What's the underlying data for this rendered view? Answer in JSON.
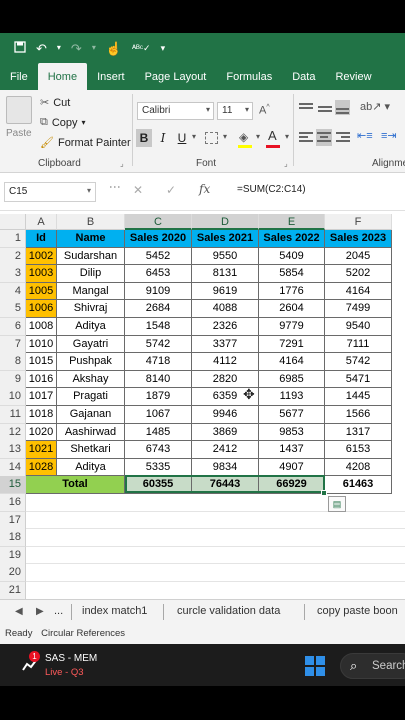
{
  "ribbon": {
    "tabs": [
      "File",
      "Home",
      "Insert",
      "Page Layout",
      "Formulas",
      "Data",
      "Review"
    ],
    "active_tab": "Home",
    "clipboard": {
      "paste": "Paste",
      "cut": "Cut",
      "copy": "Copy",
      "format_painter": "Format Painter",
      "group": "Clipboard"
    },
    "font": {
      "name": "Calibri",
      "size": "11",
      "group": "Font"
    },
    "alignment": {
      "group": "Alignme"
    }
  },
  "formula_bar": {
    "name_box": "C15",
    "formula": "=SUM(C2:C14)"
  },
  "grid": {
    "column_letters": [
      "A",
      "B",
      "C",
      "D",
      "E",
      "F"
    ],
    "row_numbers": [
      "1",
      "2",
      "3",
      "4",
      "5",
      "6",
      "7",
      "8",
      "9",
      "10",
      "11",
      "12",
      "13",
      "14",
      "15",
      "16",
      "17",
      "18",
      "19",
      "20",
      "21"
    ],
    "header": [
      "Id",
      "Name",
      "Sales 2020",
      "Sales 2021",
      "Sales 2022",
      "Sales 2023"
    ],
    "rows": [
      [
        "1002",
        "Sudarshan",
        "5452",
        "9550",
        "5409",
        "2045"
      ],
      [
        "1003",
        "Dilip",
        "6453",
        "8131",
        "5854",
        "5202"
      ],
      [
        "1005",
        "Mangal",
        "9109",
        "9619",
        "1776",
        "4164"
      ],
      [
        "1006",
        "Shivraj",
        "2684",
        "4088",
        "2604",
        "7499"
      ],
      [
        "1008",
        "Aditya",
        "1548",
        "2326",
        "9779",
        "9540"
      ],
      [
        "1010",
        "Gayatri",
        "5742",
        "3377",
        "7291",
        "7111"
      ],
      [
        "1015",
        "Pushpak",
        "4718",
        "4112",
        "4164",
        "5742"
      ],
      [
        "1016",
        "Akshay",
        "8140",
        "2820",
        "6985",
        "5471"
      ],
      [
        "1017",
        "Pragati",
        "1879",
        "6359",
        "1193",
        "1445"
      ],
      [
        "1018",
        "Gajanan",
        "1067",
        "9946",
        "5677",
        "1566"
      ],
      [
        "1020",
        "Aashirwad",
        "1485",
        "3869",
        "9853",
        "1317"
      ],
      [
        "1021",
        "Shetkari",
        "6743",
        "2412",
        "1437",
        "6153"
      ],
      [
        "1028",
        "Aditya",
        "5335",
        "9834",
        "4907",
        "4208"
      ]
    ],
    "highlighted_id_rows": [
      0,
      1,
      2,
      3,
      11,
      12
    ],
    "total": {
      "label": "Total",
      "values": [
        "60355",
        "76443",
        "66929",
        "61463"
      ]
    }
  },
  "sheet_tabs": {
    "more": "...",
    "tabs": [
      "index match1",
      "curcle validation data",
      "copy paste boon"
    ]
  },
  "status_bar": {
    "ready": "Ready",
    "message": "Circular References"
  },
  "taskbar": {
    "badge": "1",
    "stock_title": "SAS - MEM",
    "stock_sub": "Live - Q3",
    "search": "Search"
  },
  "colors": {
    "excel_green": "#217346",
    "header_fill": "#00b0f0",
    "id_highlight": "#ffc000",
    "total_fill": "#92d050"
  }
}
